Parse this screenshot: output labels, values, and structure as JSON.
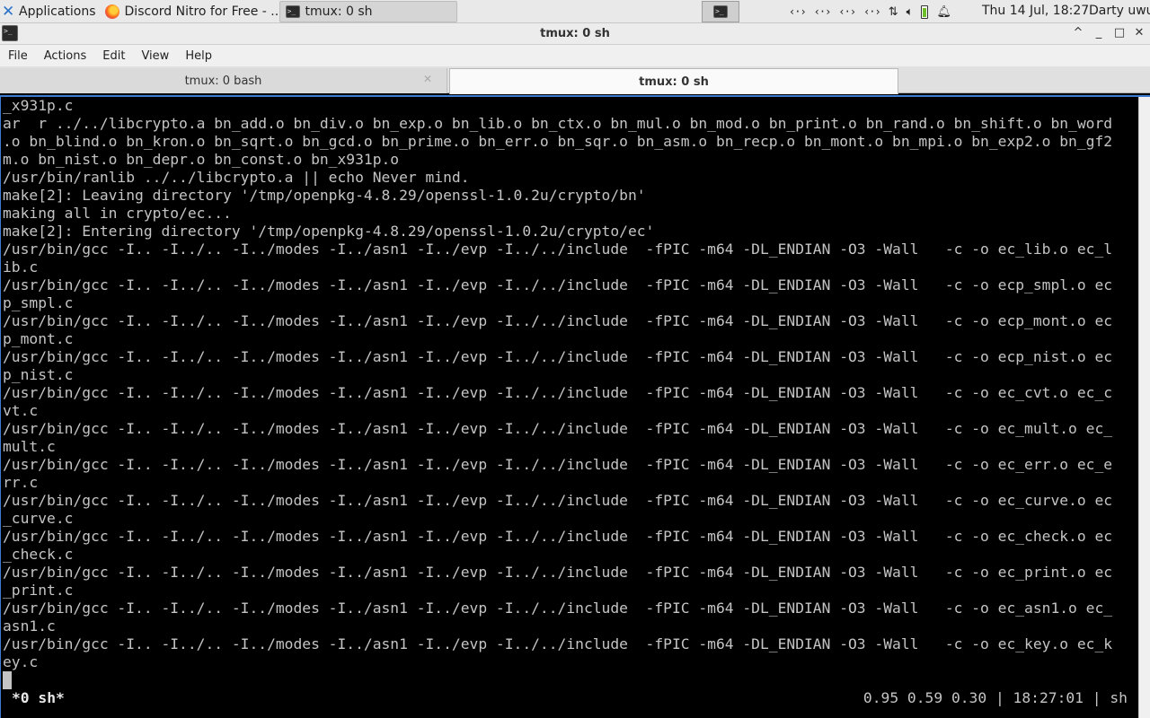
{
  "panel": {
    "applications": "Applications",
    "task_browser": "Discord Nitro for Free - ...",
    "task_terminal": "tmux: 0 sh",
    "clock": "Thu 14 Jul, 18:27",
    "user": "Darty uwu"
  },
  "window": {
    "title": "tmux: 0 sh"
  },
  "menu": [
    "File",
    "Actions",
    "Edit",
    "View",
    "Help"
  ],
  "tabs": {
    "inactive": "tmux: 0 bash",
    "active": "tmux: 0 sh"
  },
  "terminal": {
    "lines": [
      "_x931p.c",
      "ar  r ../../libcrypto.a bn_add.o bn_div.o bn_exp.o bn_lib.o bn_ctx.o bn_mul.o bn_mod.o bn_print.o bn_rand.o bn_shift.o bn_word",
      ".o bn_blind.o bn_kron.o bn_sqrt.o bn_gcd.o bn_prime.o bn_err.o bn_sqr.o bn_asm.o bn_recp.o bn_mont.o bn_mpi.o bn_exp2.o bn_gf2",
      "m.o bn_nist.o bn_depr.o bn_const.o bn_x931p.o",
      "/usr/bin/ranlib ../../libcrypto.a || echo Never mind.",
      "make[2]: Leaving directory '/tmp/openpkg-4.8.29/openssl-1.0.2u/crypto/bn'",
      "making all in crypto/ec...",
      "make[2]: Entering directory '/tmp/openpkg-4.8.29/openssl-1.0.2u/crypto/ec'",
      "/usr/bin/gcc -I.. -I../.. -I../modes -I../asn1 -I../evp -I../../include  -fPIC -m64 -DL_ENDIAN -O3 -Wall   -c -o ec_lib.o ec_l",
      "ib.c",
      "/usr/bin/gcc -I.. -I../.. -I../modes -I../asn1 -I../evp -I../../include  -fPIC -m64 -DL_ENDIAN -O3 -Wall   -c -o ecp_smpl.o ec",
      "p_smpl.c",
      "/usr/bin/gcc -I.. -I../.. -I../modes -I../asn1 -I../evp -I../../include  -fPIC -m64 -DL_ENDIAN -O3 -Wall   -c -o ecp_mont.o ec",
      "p_mont.c",
      "/usr/bin/gcc -I.. -I../.. -I../modes -I../asn1 -I../evp -I../../include  -fPIC -m64 -DL_ENDIAN -O3 -Wall   -c -o ecp_nist.o ec",
      "p_nist.c",
      "/usr/bin/gcc -I.. -I../.. -I../modes -I../asn1 -I../evp -I../../include  -fPIC -m64 -DL_ENDIAN -O3 -Wall   -c -o ec_cvt.o ec_c",
      "vt.c",
      "/usr/bin/gcc -I.. -I../.. -I../modes -I../asn1 -I../evp -I../../include  -fPIC -m64 -DL_ENDIAN -O3 -Wall   -c -o ec_mult.o ec_",
      "mult.c",
      "/usr/bin/gcc -I.. -I../.. -I../modes -I../asn1 -I../evp -I../../include  -fPIC -m64 -DL_ENDIAN -O3 -Wall   -c -o ec_err.o ec_e",
      "rr.c",
      "/usr/bin/gcc -I.. -I../.. -I../modes -I../asn1 -I../evp -I../../include  -fPIC -m64 -DL_ENDIAN -O3 -Wall   -c -o ec_curve.o ec",
      "_curve.c",
      "/usr/bin/gcc -I.. -I../.. -I../modes -I../asn1 -I../evp -I../../include  -fPIC -m64 -DL_ENDIAN -O3 -Wall   -c -o ec_check.o ec",
      "_check.c",
      "/usr/bin/gcc -I.. -I../.. -I../modes -I../asn1 -I../evp -I../../include  -fPIC -m64 -DL_ENDIAN -O3 -Wall   -c -o ec_print.o ec",
      "_print.c",
      "/usr/bin/gcc -I.. -I../.. -I../modes -I../asn1 -I../evp -I../../include  -fPIC -m64 -DL_ENDIAN -O3 -Wall   -c -o ec_asn1.o ec_",
      "asn1.c",
      "/usr/bin/gcc -I.. -I../.. -I../modes -I../asn1 -I../evp -I../../include  -fPIC -m64 -DL_ENDIAN -O3 -Wall   -c -o ec_key.o ec_k",
      "ey.c"
    ],
    "status_left": "*0 sh*",
    "status_right": "0.95 0.59 0.30 | 18:27:01 | sh"
  }
}
